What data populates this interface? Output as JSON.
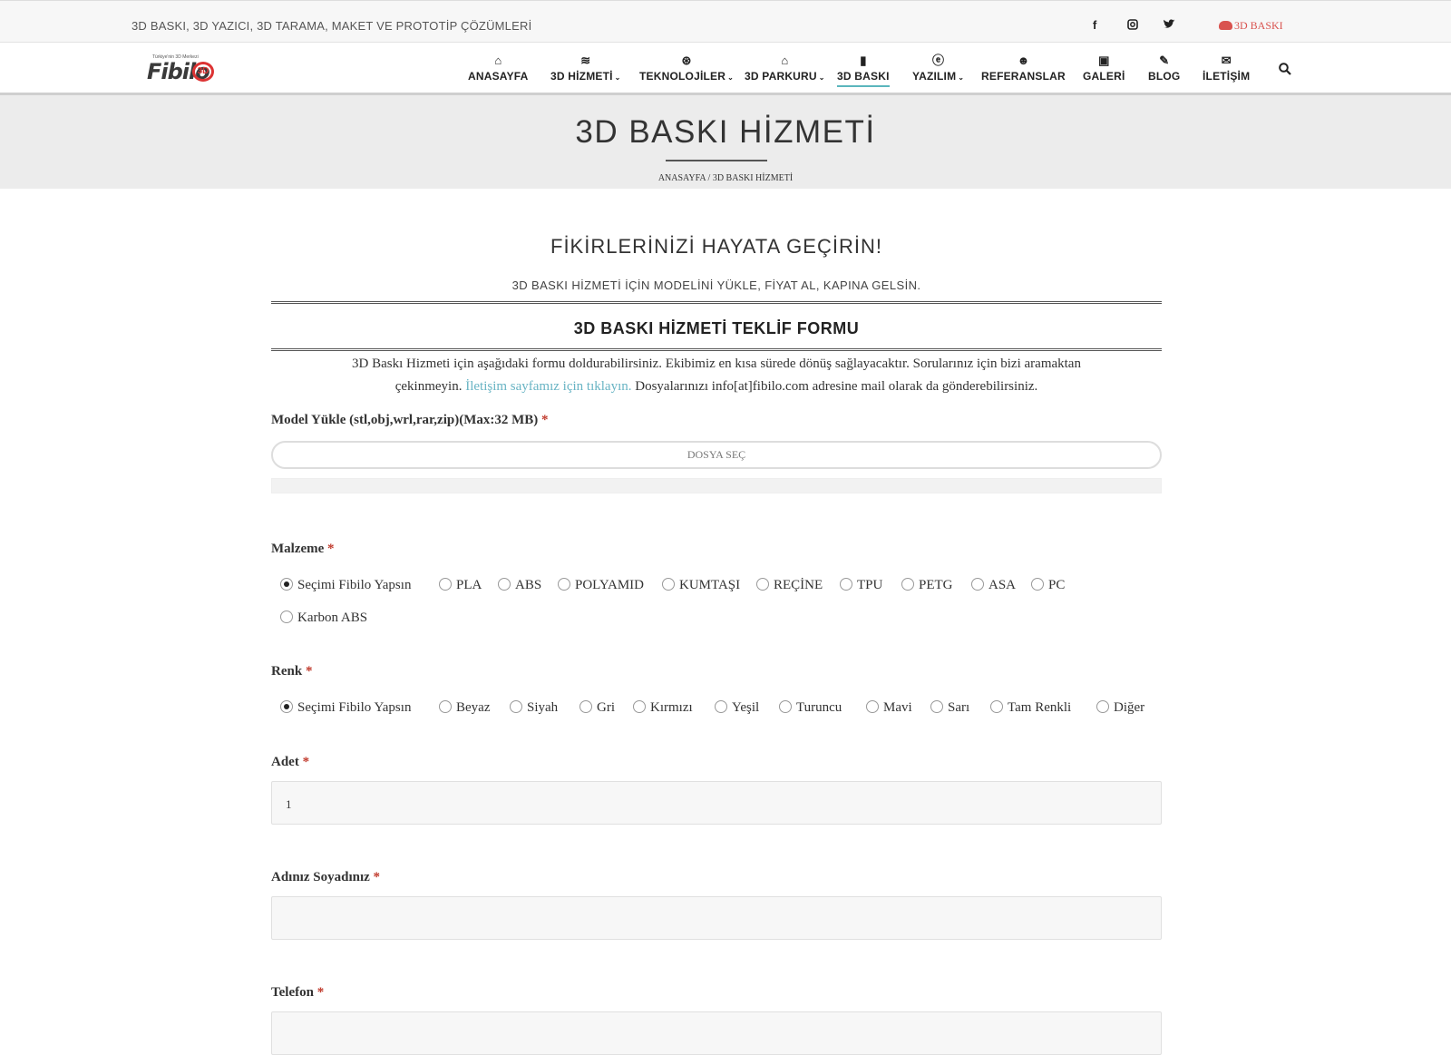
{
  "topbar": {
    "tagline": "3D BASKI, 3D YAZICI, 3D TARAMA, MAKET VE PROTOTİP ÇÖZÜMLERİ",
    "social": [
      "f",
      "◘",
      "t"
    ],
    "cta_label": "3D BASKI"
  },
  "logo": {
    "small_text": "Türkiye'nin 3D Merkezi",
    "word": "Fibilo",
    "badge": "3D"
  },
  "menu": [
    {
      "label": "ANASAYFA",
      "icon": "home-icon",
      "glyph": "⌂",
      "dropdown": false
    },
    {
      "label": "3D HİZMETİ",
      "icon": "css3-icon",
      "glyph": "≋",
      "dropdown": true
    },
    {
      "label": "TEKNOLOJİLER",
      "icon": "dribbble-icon",
      "glyph": "⊛",
      "dropdown": true
    },
    {
      "label": "3D PARKURU",
      "icon": "robot-icon",
      "glyph": "⌂",
      "dropdown": true
    },
    {
      "label": "3D BASKI",
      "icon": "clipboard-icon",
      "glyph": "▮",
      "dropdown": false,
      "active": true
    },
    {
      "label": "YAZILIM",
      "icon": "weibo-icon",
      "glyph": "ⓔ",
      "dropdown": true
    },
    {
      "label": "REFERANSLAR",
      "icon": "users-icon",
      "glyph": "☻",
      "dropdown": false
    },
    {
      "label": "GALERİ",
      "icon": "image-icon",
      "glyph": "▣",
      "dropdown": false
    },
    {
      "label": "BLOG",
      "icon": "pencil-icon",
      "glyph": "✎",
      "dropdown": false
    },
    {
      "label": "İLETİŞİM",
      "icon": "envelope-icon",
      "glyph": "✉",
      "dropdown": false
    }
  ],
  "page": {
    "title": "3D BASKI HİZMETİ",
    "breadcrumb": "ANASAYFA / 3D BASKI HİZMETİ",
    "headline": "FİKİRLERİNİZİ HAYATA GEÇİRİN!",
    "subheadline": "3D BASKI HİZMETİ İÇİN MODELİNİ YÜKLE, FİYAT AL, KAPINA GELSİN.",
    "form_title": "3D BASKI HİZMETİ TEKLİF FORMU",
    "intro_1": "3D Baskı Hizmeti için aşağıdaki formu doldurabilirsiniz. Ekibimiz en kısa sürede dönüş sağlayacaktır. Sorularınız için bizi aramaktan",
    "intro_2a": "çekinmeyin. ",
    "intro_link": "İletişim sayfamız için tıklayın.",
    "intro_2b": " Dosyalarınızı info[at]fibilo.com adresine mail olarak da gönderebilirsiniz."
  },
  "form": {
    "model_label": "Model Yükle (stl,obj,wrl,rar,zip)(Max:32 MB)",
    "required_mark": "*",
    "file_button": "DOSYA SEÇ",
    "material_label": "Malzeme",
    "materials": [
      "Seçimi Fibilo Yapsın",
      "PLA",
      "ABS",
      "POLYAMID",
      "KUMTAŞI",
      "REÇİNE",
      "TPU",
      "PETG",
      "ASA",
      "PC",
      "Karbon ABS"
    ],
    "material_selected": "Seçimi Fibilo Yapsın",
    "color_label": "Renk",
    "colors": [
      "Seçimi Fibilo Yapsın",
      "Beyaz",
      "Siyah",
      "Gri",
      "Kırmızı",
      "Yeşil",
      "Turuncu",
      "Mavi",
      "Sarı",
      "Tam Renkli",
      "Diğer"
    ],
    "color_selected": "Seçimi Fibilo Yapsın",
    "qty_label": "Adet",
    "qty_value": "1",
    "name_label": "Adınız Soyadınız",
    "name_value": "",
    "phone_label": "Telefon",
    "phone_value": ""
  },
  "colors": {
    "accent": "#5bb6bd",
    "cta": "#d9534f",
    "link": "#69b4c4",
    "required": "#c0392b"
  }
}
